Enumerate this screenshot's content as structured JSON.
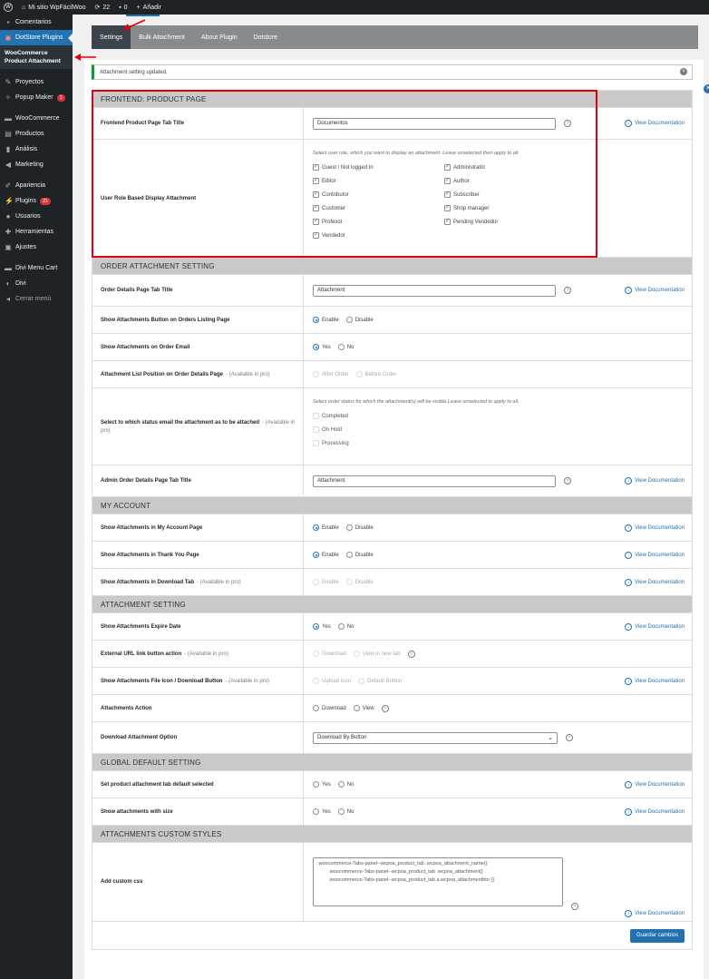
{
  "adminbar": {
    "site_name": "Mi sitio WpFácilWoo",
    "updates_count": "22",
    "comments_count": "0",
    "add_new": "Añadir"
  },
  "sidebar": {
    "items": [
      {
        "label": "Comentarios",
        "icon": "comment-icon"
      },
      {
        "label": "DotStore Plugins",
        "icon": "dotstore-icon"
      },
      {
        "label": "WooCommerce Product Attachment",
        "icon": ""
      },
      {
        "label": "Proyectos",
        "icon": "pin-icon"
      },
      {
        "label": "Popup Maker",
        "icon": "popup-icon",
        "badge": "1"
      },
      {
        "label": "WooCommerce",
        "icon": "woo-icon"
      },
      {
        "label": "Productos",
        "icon": "archive-icon"
      },
      {
        "label": "Análisis",
        "icon": "chart-icon"
      },
      {
        "label": "Marketing",
        "icon": "megaphone-icon"
      },
      {
        "label": "Apariencia",
        "icon": "brush-icon"
      },
      {
        "label": "Plugins",
        "icon": "plugin-icon",
        "badge": "21"
      },
      {
        "label": "Usuarios",
        "icon": "user-icon"
      },
      {
        "label": "Herramientas",
        "icon": "wrench-icon"
      },
      {
        "label": "Ajustes",
        "icon": "settings-icon"
      },
      {
        "label": "Divi Menu Cart",
        "icon": "divi-cart-icon"
      },
      {
        "label": "Divi",
        "icon": "divi-icon"
      },
      {
        "label": "Cerrar menú",
        "icon": "collapse-icon"
      }
    ]
  },
  "tabs": [
    "Settings",
    "Bulk Attachment",
    "About Plugin",
    "Dotstore"
  ],
  "notice": "Attachment setting updated.",
  "doc_link": "View Documentation",
  "sections": {
    "frontend": "FRONTEND: PRODUCT PAGE",
    "order": "ORDER ATTACHMENT SETTING",
    "account": "MY ACCOUNT",
    "attachment": "ATTACHMENT SETTING",
    "global": "GLOBAL DEFAULT SETTING",
    "custom": "ATTACHMENTS CUSTOM STYLES"
  },
  "pro_tag": "- (Available in pro)",
  "frontend": {
    "tab_title_label": "Frontend Product Page Tab Title",
    "tab_title_value": "Documentos",
    "role_label": "User Role Based Display Attachment",
    "role_note": "Select user role, which you want to display an attachment. Leave unselected then apply to all.",
    "roles_left": [
      "Guest / Not logged In",
      "Editor",
      "Contributor",
      "Customer",
      "Profesor",
      "Vendedor"
    ],
    "roles_right": [
      "Administrator",
      "Author",
      "Subscriber",
      "Shop manager",
      "Pending Vendedor"
    ]
  },
  "order": {
    "tab_title_label": "Order Details Page Tab Title",
    "tab_title_value": "Attachment",
    "listing_label": "Show Attachments Button on Orders Listing Page",
    "email_label": "Show Attachments on Order Email",
    "position_label": "Attachment List Position on Order Details Page",
    "position_opts": [
      "After Order",
      "Before Order"
    ],
    "status_label": "Select to which status email the attachment as to be attached",
    "status_note": "Select order status for which the attachment(s) will be visible.Leave unselected to apply to all.",
    "statuses": [
      "Completed",
      "On Hold",
      "Processing"
    ],
    "admin_tab_label": "Admin Order Details Page Tab Title",
    "admin_tab_value": "Attachment"
  },
  "opts": {
    "enable": "Enable",
    "disable": "Disable",
    "yes": "Yes",
    "no": "No"
  },
  "account": {
    "page_label": "Show Attachments in My Account Page",
    "thankyou_label": "Show Attachments in Thank You Page",
    "download_tab_label": "Show Attachments in Download Tab"
  },
  "attachment": {
    "expire_label": "Show Attachments Expire Date",
    "external_label": "External URL link button action",
    "external_opts": [
      "Download",
      "View in new tab"
    ],
    "file_icon_label": "Show Attachments File Icon / Download Button",
    "file_icon_opts": [
      "Upload Icon",
      "Default Button"
    ],
    "action_label": "Attachments Action",
    "action_opts": [
      "Download",
      "View"
    ],
    "download_option_label": "Download Attachment Option",
    "download_option_value": "Download By Button"
  },
  "global": {
    "default_selected_label": "Set product attachment tab default selected",
    "with_size_label": "Show attachments with size"
  },
  "custom": {
    "css_label": "Add custom css",
    "css_value": ".woocommerce-Tabs-panel--wcpoa_product_tab .wcpoa_attachment_name{}\n        .woocommerce-Tabs-panel--wcpoa_product_tab .wcpoa_attachment{}\n        .woocommerce-Tabs-panel--wcpoa_product_tab a.wcpoa_attachmentbtn {}"
  },
  "save_button": "Guardar cambios",
  "colors": {
    "accent": "#2271b1",
    "highlight": "#e0000f",
    "sidebar": "#1d2327"
  }
}
